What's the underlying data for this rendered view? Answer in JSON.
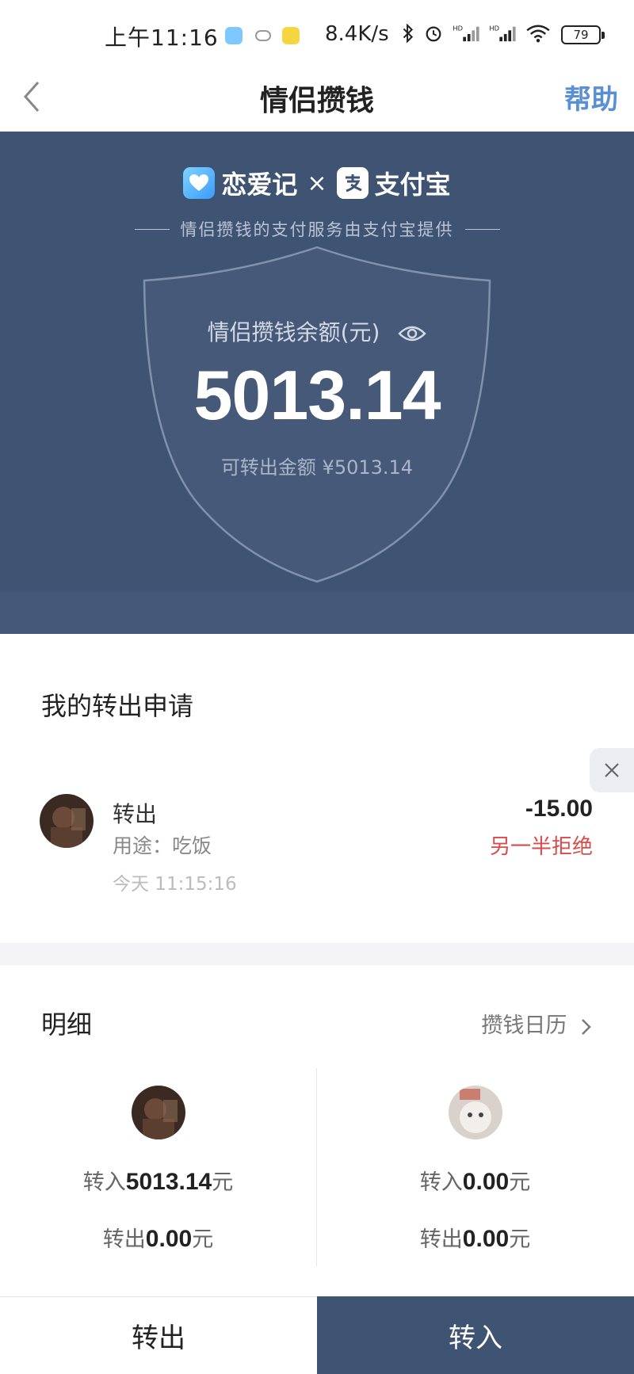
{
  "status_bar": {
    "time": "上午11:16",
    "network_speed": "8.4K/s",
    "battery": "79"
  },
  "nav": {
    "title": "情侣攒钱",
    "help": "帮助"
  },
  "hero": {
    "brand_left": "恋爱记",
    "brand_sep": "×",
    "brand_right": "支付宝",
    "service_note": "情侣攒钱的支付服务由支付宝提供",
    "balance_label": "情侣攒钱余额(元)",
    "balance": "5013.14",
    "transferable": "可转出金额 ¥5013.14",
    "colors": {
      "background": "#3f5373",
      "love_logo": "#5ab3ff",
      "alipay_logo": "#ffffff"
    }
  },
  "applications": {
    "title": "我的转出申请",
    "item": {
      "kind": "转出",
      "purpose": "用途：吃饭",
      "time": "今天 11:15:16",
      "amount": "-15.00",
      "status": "另一半拒绝",
      "status_color": "#d94b4b"
    }
  },
  "detail": {
    "title": "明细",
    "calendar_link": "攒钱日历",
    "left": {
      "in_prefix": "转入",
      "in_value": "5013.14",
      "in_unit": "元",
      "out_prefix": "转出",
      "out_value": "0.00",
      "out_unit": "元"
    },
    "right": {
      "in_prefix": "转入",
      "in_value": "0.00",
      "in_unit": "元",
      "out_prefix": "转出",
      "out_value": "0.00",
      "out_unit": "元"
    }
  },
  "actions": {
    "transfer_out": "转出",
    "transfer_in": "转入"
  }
}
